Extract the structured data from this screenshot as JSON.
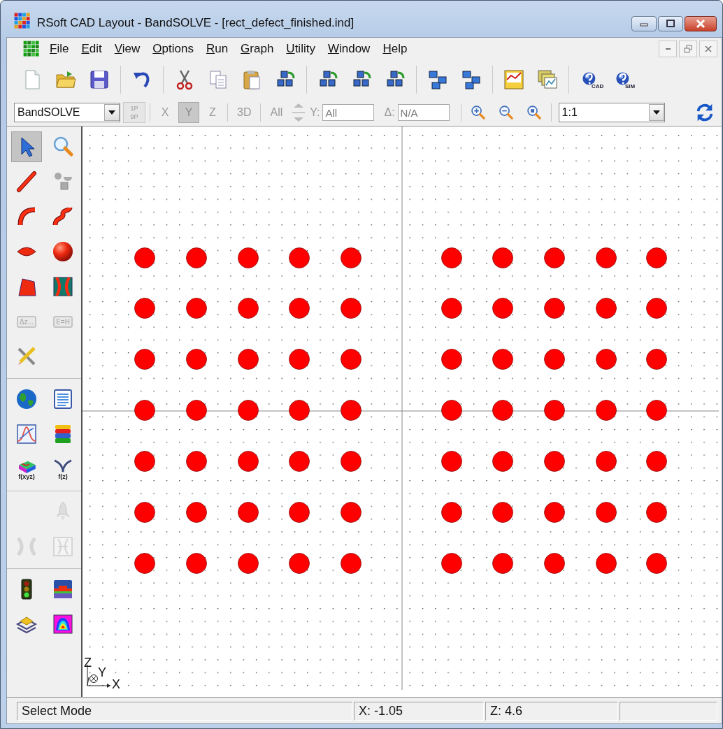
{
  "window": {
    "title": "RSoft CAD Layout - BandSOLVE - [rect_defect_finished.ind]"
  },
  "menu": [
    "File",
    "Edit",
    "View",
    "Options",
    "Run",
    "Graph",
    "Utility",
    "Window",
    "Help"
  ],
  "toolbar": [
    {
      "kind": "new"
    },
    {
      "kind": "open"
    },
    {
      "kind": "save"
    },
    {
      "kind": "separator"
    },
    {
      "kind": "undo"
    },
    {
      "kind": "separator"
    },
    {
      "kind": "cut"
    },
    {
      "kind": "copy"
    },
    {
      "kind": "paste"
    },
    {
      "kind": "cubes"
    },
    {
      "kind": "separator"
    },
    {
      "kind": "cubes"
    },
    {
      "kind": "cubes"
    },
    {
      "kind": "cubes"
    },
    {
      "kind": "separator"
    },
    {
      "kind": "blocks"
    },
    {
      "kind": "blocks"
    },
    {
      "kind": "separator"
    },
    {
      "kind": "chart"
    },
    {
      "kind": "windows"
    },
    {
      "kind": "separator"
    },
    {
      "kind": "help",
      "caption": "CAD"
    },
    {
      "kind": "help",
      "caption": "SIM"
    }
  ],
  "view_toolbar": [
    {
      "kind": "combo",
      "value": "BandSOLVE"
    },
    {
      "kind": "pane",
      "top": "1P",
      "bottom": "9P"
    },
    {
      "kind": "separator"
    },
    {
      "kind": "toggle",
      "label": "X",
      "selected": false
    },
    {
      "kind": "toggle",
      "label": "Y",
      "selected": true
    },
    {
      "kind": "toggle",
      "label": "Z",
      "selected": false
    },
    {
      "kind": "separator"
    },
    {
      "kind": "toggle",
      "label": "3D",
      "selected": false
    },
    {
      "kind": "separator"
    },
    {
      "kind": "toggle",
      "label": "All",
      "selected": false
    },
    {
      "kind": "spin"
    },
    {
      "kind": "field",
      "label": "Y:",
      "value": "All"
    },
    {
      "kind": "field",
      "label": "Δ:",
      "value": "N/A"
    },
    {
      "kind": "separator"
    },
    {
      "kind": "zoom-in"
    },
    {
      "kind": "zoom-out"
    },
    {
      "kind": "zoom-fit"
    },
    {
      "kind": "separator"
    },
    {
      "kind": "zoom-combo",
      "value": "1:1"
    },
    {
      "kind": "refresh"
    }
  ],
  "palette": [
    {
      "tools": [
        {
          "kind": "select",
          "selected": true,
          "disabled": false
        },
        {
          "kind": "zoom",
          "selected": false,
          "disabled": false
        },
        {
          "kind": "line",
          "selected": false,
          "disabled": false
        },
        {
          "kind": "shapes",
          "selected": false,
          "disabled": false
        },
        {
          "kind": "arc",
          "selected": false,
          "disabled": false
        },
        {
          "kind": "sbend",
          "selected": false,
          "disabled": false
        },
        {
          "kind": "lens",
          "selected": false,
          "disabled": false
        },
        {
          "kind": "sphere",
          "selected": false,
          "disabled": false
        },
        {
          "kind": "taper",
          "selected": false,
          "disabled": false
        },
        {
          "kind": "coupler",
          "selected": false,
          "disabled": false
        },
        {
          "kind": "label",
          "caption": "Δz...",
          "selected": false,
          "disabled": true
        },
        {
          "kind": "label",
          "caption": "E=H",
          "selected": false,
          "disabled": true
        },
        {
          "kind": "tools",
          "selected": false,
          "disabled": false
        },
        {
          "kind": "blank"
        }
      ]
    },
    {
      "tools": [
        {
          "kind": "globe",
          "selected": false,
          "disabled": false
        },
        {
          "kind": "document",
          "selected": false,
          "disabled": false
        },
        {
          "kind": "plot",
          "selected": false,
          "disabled": false
        },
        {
          "kind": "layers",
          "selected": false,
          "disabled": false
        },
        {
          "kind": "block",
          "caption": "f(xyz)",
          "selected": false,
          "disabled": false
        },
        {
          "kind": "branch",
          "caption": "f(z)",
          "selected": false,
          "disabled": false
        }
      ]
    },
    {
      "tools": [
        {
          "kind": "blank"
        },
        {
          "kind": "rocket",
          "selected": false,
          "disabled": true
        },
        {
          "kind": "xcross",
          "selected": false,
          "disabled": true
        },
        {
          "kind": "boxcross",
          "selected": false,
          "disabled": true
        }
      ]
    },
    {
      "tools": [
        {
          "kind": "traffic",
          "selected": false,
          "disabled": false
        },
        {
          "kind": "slab",
          "selected": false,
          "disabled": false
        },
        {
          "kind": "stack",
          "selected": false,
          "disabled": false
        },
        {
          "kind": "mode",
          "selected": false,
          "disabled": false
        }
      ]
    }
  ],
  "canvas": {
    "axes": {
      "vertical": "Z",
      "depth": "Y",
      "horizontal": "X"
    }
  },
  "status_bar": [
    "Select Mode",
    "X: -1.05",
    "Z: 4.6"
  ]
}
